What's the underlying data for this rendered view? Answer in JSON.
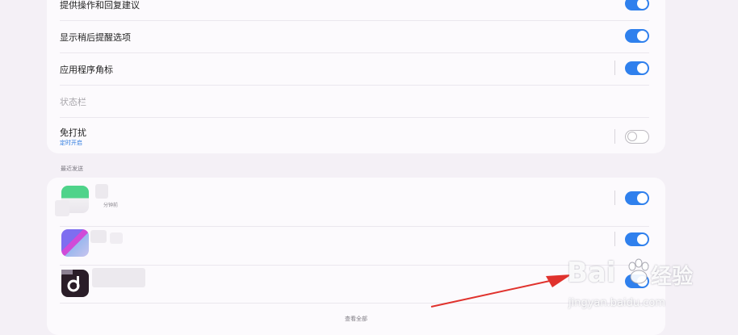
{
  "settings": [
    {
      "label": "提供操作和回复建议",
      "toggle": "on"
    },
    {
      "label": "显示稍后提醒选项",
      "toggle": "on"
    },
    {
      "label": "应用程序角标",
      "toggle": "on"
    },
    {
      "label": "状态栏"
    },
    {
      "label": "免打扰",
      "sub": "定时开启",
      "toggle": "off"
    }
  ],
  "recent": {
    "title": "最近发送",
    "items": [
      {
        "time": "分钟前",
        "toggle": "on"
      },
      {
        "toggle": "on"
      },
      {
        "toggle": "on"
      }
    ],
    "view_all": "查看全部"
  },
  "watermark": {
    "brand": "Bai",
    "brand2": "经验",
    "url": "jingyan.baidu.com"
  },
  "colors": {
    "accent": "#2f80ed",
    "arrow": "#e0322d",
    "background": "#f4f0f6",
    "card": "#fcfafd"
  }
}
